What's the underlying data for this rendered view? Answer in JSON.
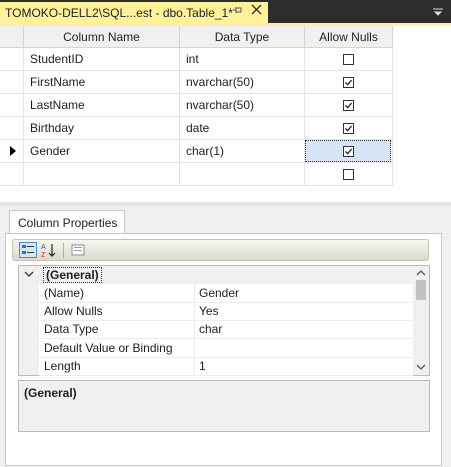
{
  "tab": {
    "title": "TOMOKO-DELL2\\SQL...est - dbo.Table_1*"
  },
  "grid": {
    "headers": [
      "Column Name",
      "Data Type",
      "Allow Nulls"
    ],
    "rows": [
      {
        "name": "StudentID",
        "type": "int",
        "allow_nulls": false
      },
      {
        "name": "FirstName",
        "type": "nvarchar(50)",
        "allow_nulls": true
      },
      {
        "name": "LastName",
        "type": "nvarchar(50)",
        "allow_nulls": true
      },
      {
        "name": "Birthday",
        "type": "date",
        "allow_nulls": true
      },
      {
        "name": "Gender",
        "type": "char(1)",
        "allow_nulls": true,
        "selected": true
      },
      {
        "name": "",
        "type": "",
        "allow_nulls": false
      }
    ]
  },
  "properties": {
    "tab_label": "Column Properties",
    "category": "(General)",
    "items": [
      {
        "name": "(Name)",
        "value": "Gender"
      },
      {
        "name": "Allow Nulls",
        "value": "Yes"
      },
      {
        "name": "Data Type",
        "value": "char"
      },
      {
        "name": "Default Value or Binding",
        "value": ""
      },
      {
        "name": "Length",
        "value": "1"
      }
    ],
    "description_title": "(General)"
  },
  "colors": {
    "tab_accent": "#fff29d",
    "chrome": "#2d2d30",
    "selection": "#d6e4f5"
  }
}
